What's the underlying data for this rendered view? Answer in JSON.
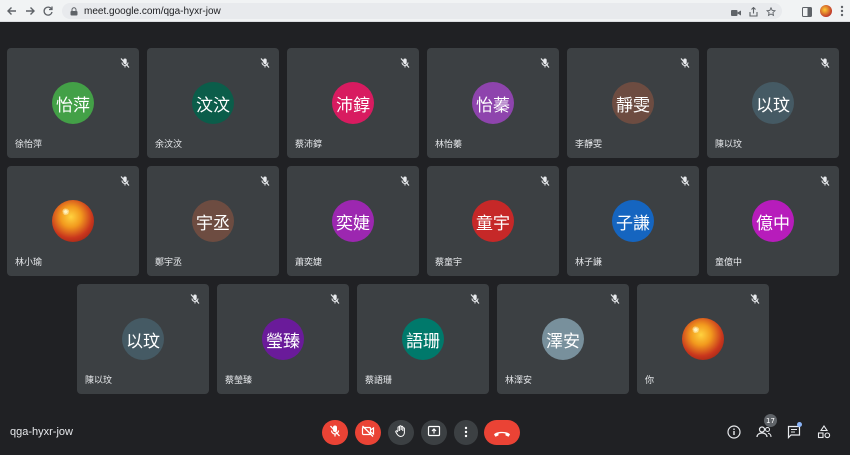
{
  "browser": {
    "url": "meet.google.com/qga-hyxr-jow"
  },
  "meeting": {
    "code": "qga-hyxr-jow",
    "participant_count": "17"
  },
  "tiles": [
    {
      "initials": "怡萍",
      "name": "徐怡萍",
      "color": "#43a047"
    },
    {
      "initials": "汶汶",
      "name": "余汶汶",
      "color": "#0b5d4a"
    },
    {
      "initials": "沛錞",
      "name": "蔡沛錞",
      "color": "#d81b60"
    },
    {
      "initials": "怡蓁",
      "name": "林怡蓁",
      "color": "#8e44ad"
    },
    {
      "initials": "靜雯",
      "name": "李靜雯",
      "color": "#6d4c41"
    },
    {
      "initials": "以玟",
      "name": "陳以玟",
      "color": "#455a64"
    },
    {
      "initials": "",
      "name": "林小瑜",
      "color": "#c0392b",
      "photo": true
    },
    {
      "initials": "宇丞",
      "name": "鄭宇丞",
      "color": "#6d4c41"
    },
    {
      "initials": "奕婕",
      "name": "蕭奕婕",
      "color": "#9c27b0"
    },
    {
      "initials": "童宇",
      "name": "蔡童宇",
      "color": "#c62828"
    },
    {
      "initials": "子謙",
      "name": "林子謙",
      "color": "#1565c0"
    },
    {
      "initials": "億中",
      "name": "童億中",
      "color": "#b71cbb"
    },
    {
      "initials": "以玟",
      "name": "陳以玟",
      "color": "#455a64"
    },
    {
      "initials": "瑩臻",
      "name": "蔡瑩臻",
      "color": "#6a1b9a"
    },
    {
      "initials": "語珊",
      "name": "蔡語珊",
      "color": "#00796b"
    },
    {
      "initials": "澤安",
      "name": "林澤安",
      "color": "#78909c"
    },
    {
      "initials": "",
      "name": "你",
      "color": "#c0392b",
      "photo": true
    }
  ],
  "controls": {
    "mic_color": "#ea4335",
    "camera_color": "#ea4335",
    "end_call_color": "#ea4335"
  }
}
